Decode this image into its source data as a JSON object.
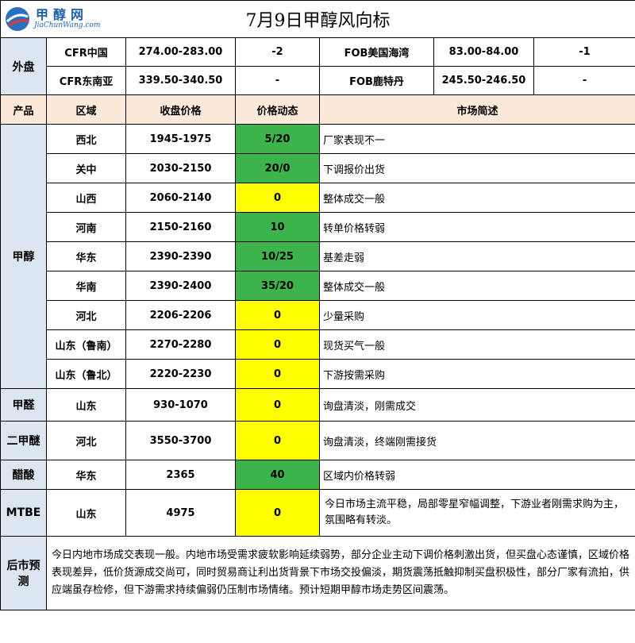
{
  "logo": {
    "cn": "甲醇网",
    "en": "JiaChunWang.com"
  },
  "title": "7月9日甲醇风向标",
  "foreign": {
    "label": "外盘",
    "rows": [
      {
        "a_name": "CFR中国",
        "a_price": "274.00-283.00",
        "a_change": "-2",
        "b_name": "FOB美国海湾",
        "b_price": "83.00-84.00",
        "b_change": "-1"
      },
      {
        "a_name": "CFR东南亚",
        "a_price": "339.50-340.50",
        "a_change": "-",
        "b_name": "FOB鹿特丹",
        "b_price": "245.50-246.50",
        "b_change": "-"
      }
    ]
  },
  "header": {
    "product": "产品",
    "region": "区域",
    "price": "收盘价格",
    "change": "价格动态",
    "desc": "市场简述"
  },
  "methanol": {
    "label": "甲醇",
    "rows": [
      {
        "region": "西北",
        "price": "1945-1975",
        "change": "5/20",
        "desc": "厂家表现不一"
      },
      {
        "region": "关中",
        "price": "2030-2150",
        "change": "20/0",
        "desc": "下调报价出货"
      },
      {
        "region": "山西",
        "price": "2060-2140",
        "change": "0",
        "desc": "整体成交一般"
      },
      {
        "region": "河南",
        "price": "2150-2160",
        "change": "10",
        "desc": "转单价格转弱"
      },
      {
        "region": "华东",
        "price": "2390-2390",
        "change": "10/25",
        "desc": "基差走弱"
      },
      {
        "region": "华南",
        "price": "2390-2400",
        "change": "35/20",
        "desc": "整体成交一般"
      },
      {
        "region": "河北",
        "price": "2206-2206",
        "change": "0",
        "desc": "少量采购"
      },
      {
        "region": "山东（鲁南）",
        "price": "2270-2280",
        "change": "0",
        "desc": "现货买气一般"
      },
      {
        "region": "山东（鲁北）",
        "price": "2220-2230",
        "change": "0",
        "desc": "下游按需采购"
      }
    ]
  },
  "others": [
    {
      "product": "甲醛",
      "region": "山东",
      "price": "930-1070",
      "change": "0",
      "desc": "询盘清淡，刚需成交"
    },
    {
      "product": "二甲醚",
      "region": "河北",
      "price": "3550-3700",
      "change": "0",
      "desc": "询盘清淡，终端刚需接货"
    },
    {
      "product": "醋酸",
      "region": "华东",
      "price": "2365",
      "change": "40",
      "desc": "区域内价格转弱"
    },
    {
      "product": "MTBE",
      "region": "山东",
      "price": "4975",
      "change": "0",
      "desc": "今日市场主流平稳，局部零星窄幅调整，下游业者刚需求购为主，氛围略有转淡。"
    }
  ],
  "forecast": {
    "label": "后市预测",
    "text": "今日内地市场成交表现一般。内地市场受需求疲软影响延续弱势，部分企业主动下调价格刺激出货，但买盘心态谨慎，区域价格表现差异，低价货源成交尚可，同时贸易商让利出货背景下市场交投偏淡，期货震荡抵触抑制买盘积极性，部分厂家有流拍，供应端虽存检修，但下游需求持续偏弱仍压制市场情绪。预计短期甲醇市场走势区间震荡。"
  },
  "colors": {
    "green": "#3cb44b",
    "yellow": "#ffff00",
    "blue_cell": "#dce6f1",
    "header_bg": "#fde9d9"
  }
}
